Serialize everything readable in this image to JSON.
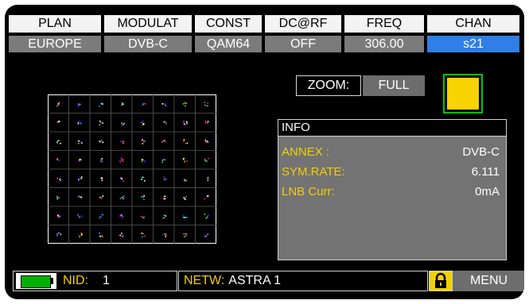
{
  "header": {
    "columns": [
      {
        "label": "PLAN",
        "value": "EUROPE"
      },
      {
        "label": "MODULAT",
        "value": "DVB-C"
      },
      {
        "label": "CONST",
        "value": "QAM64"
      },
      {
        "label": "DC@RF",
        "value": "OFF"
      },
      {
        "label": "FREQ",
        "value": "306.00"
      },
      {
        "label": "CHAN",
        "value": "s21"
      }
    ],
    "selected_index": 5
  },
  "zoom": {
    "label": "ZOOM:",
    "value": "FULL"
  },
  "signal_indicator": {
    "color": "#f7d300"
  },
  "info": {
    "title": "INFO",
    "rows": [
      {
        "key": "ANNEX  :",
        "value": "DVB-C"
      },
      {
        "key": "SYM.RATE:",
        "value": "6.111"
      },
      {
        "key": "LNB Curr:",
        "value": "0mA"
      }
    ]
  },
  "footer": {
    "nid_label": "NID:",
    "nid_value": "1",
    "netw_label": "NETW:",
    "netw_value": "ASTRA 1",
    "menu_label": "MENU",
    "battery_icon": "battery-icon",
    "lock_icon": "lock-icon"
  },
  "colors": {
    "accent_blue": "#2f7fe6",
    "key_yellow": "#f3d000",
    "panel_gray": "#737373"
  }
}
